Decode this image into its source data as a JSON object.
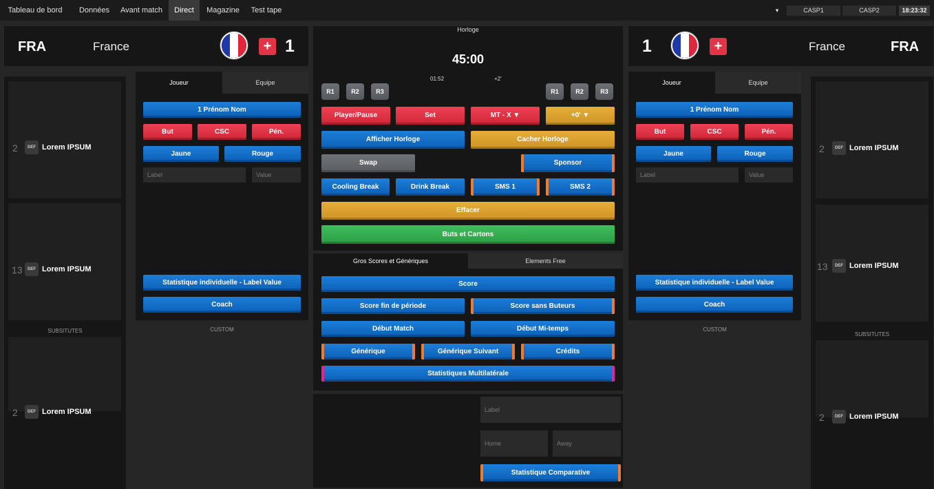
{
  "nav": {
    "tabs": [
      "Tableau de bord",
      "Données",
      "Avant match",
      "Direct",
      "Magazine",
      "Test tape"
    ],
    "active": "Direct",
    "dropdown_icon": "▾",
    "casp1": "CASP1",
    "casp2": "CASP2",
    "time": "18:23:32"
  },
  "home": {
    "abbr": "FRA",
    "name": "France",
    "score": "1",
    "plus": "+",
    "flag_colors": [
      "#1f3aa8",
      "#ffffff",
      "#e0263a"
    ]
  },
  "away": {
    "abbr": "FRA",
    "name": "France",
    "score": "1",
    "plus": "+",
    "flag_colors": [
      "#1f3aa8",
      "#ffffff",
      "#e0263a"
    ]
  },
  "left_roster": {
    "players": [
      {
        "num": "2",
        "pos": "DEF",
        "name": "Lorem IPSUM"
      },
      {
        "num": "13",
        "pos": "DEF",
        "name": "Lorem IPSUM"
      }
    ],
    "subs_label": "SUBSITUTES",
    "subs": [
      {
        "num": "2",
        "pos": "DEF",
        "name": "Lorem IPSUM"
      }
    ]
  },
  "right_roster": {
    "players": [
      {
        "num": "2",
        "pos": "DEF",
        "name": "Lorem IPSUM"
      },
      {
        "num": "13",
        "pos": "DEF",
        "name": "Lorem IPSUM"
      }
    ],
    "subs_label": "SUBSITUTES",
    "subs": [
      {
        "num": "2",
        "pos": "DEF",
        "name": "Lorem IPSUM"
      }
    ]
  },
  "left_panel": {
    "tabs": [
      "Joueur",
      "Equipe"
    ],
    "player_button": "1 Prénom Nom",
    "but": "But",
    "csc": "CSC",
    "pen": "Pén.",
    "jaune": "Jaune",
    "rouge": "Rouge",
    "label_ph": "Label",
    "value_ph": "Value",
    "stat_button": "Statistique individuelle - Label Value",
    "coach": "Coach",
    "custom": "CUSTOM"
  },
  "right_panel": {
    "tabs": [
      "Joueur",
      "Equipe"
    ],
    "player_button": "1 Prénom Nom",
    "but": "But",
    "csc": "CSC",
    "pen": "Pén.",
    "jaune": "Jaune",
    "rouge": "Rouge",
    "label_ph": "Label",
    "value_ph": "Value",
    "stat_button": "Statistique individuelle - Label Value",
    "coach": "Coach",
    "custom": "CUSTOM"
  },
  "horloge": {
    "title": "Horloge",
    "time": "45:00",
    "sub_time": "01:52",
    "added": "+2'",
    "r_left": [
      "R1",
      "R2",
      "R3"
    ],
    "r_right": [
      "R1",
      "R2",
      "R3"
    ],
    "player_pause": "Player/Pause",
    "set": "Set",
    "mt": "MT - X  ▼",
    "plus0": "+0'  ▼",
    "afficher": "Afficher Horloge",
    "cacher": "Cacher Horloge",
    "swap": "Swap",
    "sponsor": "Sponsor",
    "cooling": "Cooling Break",
    "drink": "Drink Break",
    "sms1": "SMS 1",
    "sms2": "SMS 2",
    "effacer": "Effacer",
    "buts_cartons": "Buts et Cartons"
  },
  "gros_scores": {
    "tabs": [
      "Gros Scores et Génériques",
      "Elements Free"
    ],
    "score": "Score",
    "score_fin": "Score fin de période",
    "score_sans": "Score sans Buteurs",
    "debut_match": "Début Match",
    "debut_mi": "Début Mi-temps",
    "generique": "Générique",
    "generique_suivant": "Générique Suivant",
    "credits": "Crédits",
    "stats_multi": "Statistiques Multilatérale"
  },
  "comparative": {
    "label_ph": "Label",
    "home_ph": "Home",
    "away_ph": "Away",
    "button": "Statistique Comparative"
  }
}
